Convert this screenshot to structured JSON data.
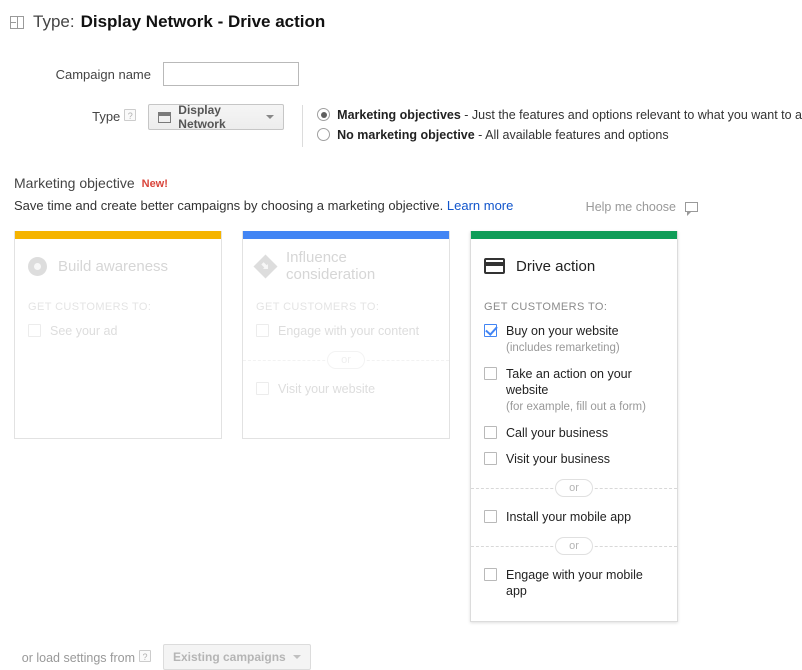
{
  "header": {
    "icon": "panel-layout-icon",
    "label": "Type:",
    "title": "Display Network - Drive action"
  },
  "form": {
    "campaign_name_label": "Campaign name",
    "campaign_name_value": "",
    "campaign_name_placeholder": "",
    "type_label": "Type",
    "help_marker": "?",
    "type_button": "Display Network",
    "type_button_icon": "monitor-icon",
    "radios": [
      {
        "checked": true,
        "strong": "Marketing objectives",
        "rest": " - Just the features and options relevant to what you want to a"
      },
      {
        "checked": false,
        "strong": "No marketing objective",
        "rest": " - All available features and options"
      }
    ]
  },
  "objective": {
    "title": "Marketing objective",
    "badge": "New!",
    "description": "Save time and create better campaigns by choosing a marketing objective.",
    "learn_more": "Learn more",
    "help_me_choose": "Help me choose",
    "help_icon": "speech-bubble-icon"
  },
  "cards": [
    {
      "id": "build-awareness",
      "title": "Build awareness",
      "icon": "eye-icon",
      "bar_color": "#F5B400",
      "disabled": true,
      "get_customers_to": "GET CUSTOMERS TO:",
      "options": [
        {
          "label": "See your ad",
          "sub": "",
          "checked": false,
          "separator_before": false
        }
      ]
    },
    {
      "id": "influence-consideration",
      "title": "Influence consideration",
      "icon": "diamond-arrow-icon",
      "bar_color": "#4285F4",
      "disabled": true,
      "get_customers_to": "GET CUSTOMERS TO:",
      "options": [
        {
          "label": "Engage with your content",
          "sub": "",
          "checked": false,
          "separator_before": false
        },
        {
          "label": "Visit your website",
          "sub": "",
          "checked": false,
          "separator_before": true
        }
      ]
    },
    {
      "id": "drive-action",
      "title": "Drive action",
      "icon": "credit-card-icon",
      "bar_color": "#0F9D58",
      "disabled": false,
      "get_customers_to": "GET CUSTOMERS TO:",
      "options": [
        {
          "label": "Buy on your website",
          "sub": "(includes remarketing)",
          "checked": true,
          "separator_before": false
        },
        {
          "label": "Take an action on your website",
          "sub": "(for example, fill out a form)",
          "checked": false,
          "separator_before": false
        },
        {
          "label": "Call your business",
          "sub": "",
          "checked": false,
          "separator_before": false
        },
        {
          "label": "Visit your business",
          "sub": "",
          "checked": false,
          "separator_before": false
        },
        {
          "label": "Install your mobile app",
          "sub": "",
          "checked": false,
          "separator_before": true
        },
        {
          "label": "Engage with your mobile app",
          "sub": "",
          "checked": false,
          "separator_before": true
        }
      ]
    }
  ],
  "separator_label": "or",
  "footer": {
    "label": "or load settings from",
    "help_marker": "?",
    "button": "Existing campaigns"
  }
}
